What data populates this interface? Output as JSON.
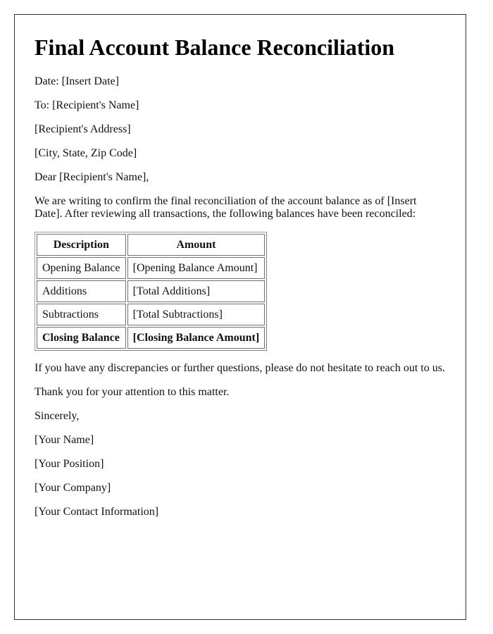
{
  "document": {
    "title": "Final Account Balance Reconciliation",
    "date_line": "Date: [Insert Date]",
    "to_line": "To: [Recipient's Name]",
    "address_line": "[Recipient's Address]",
    "city_line": "[City, State, Zip Code]",
    "salutation": "Dear [Recipient's Name],",
    "intro": "We are writing to confirm the final reconciliation of the account balance as of [Insert Date]. After reviewing all transactions, the following balances have been reconciled:",
    "table": {
      "headers": [
        "Description",
        "Amount"
      ],
      "rows": [
        {
          "description": "Opening Balance",
          "amount": "[Opening Balance Amount]",
          "bold": false
        },
        {
          "description": "Additions",
          "amount": "[Total Additions]",
          "bold": false
        },
        {
          "description": "Subtractions",
          "amount": "[Total Subtractions]",
          "bold": false
        },
        {
          "description": "Closing Balance",
          "amount": "[Closing Balance Amount]",
          "bold": true
        }
      ]
    },
    "discrepancy_note": "If you have any discrepancies or further questions, please do not hesitate to reach out to us.",
    "thanks": "Thank you for your attention to this matter.",
    "closing": "Sincerely,",
    "signature": {
      "name": "[Your Name]",
      "position": "[Your Position]",
      "company": "[Your Company]",
      "contact": "[Your Contact Information]"
    }
  }
}
